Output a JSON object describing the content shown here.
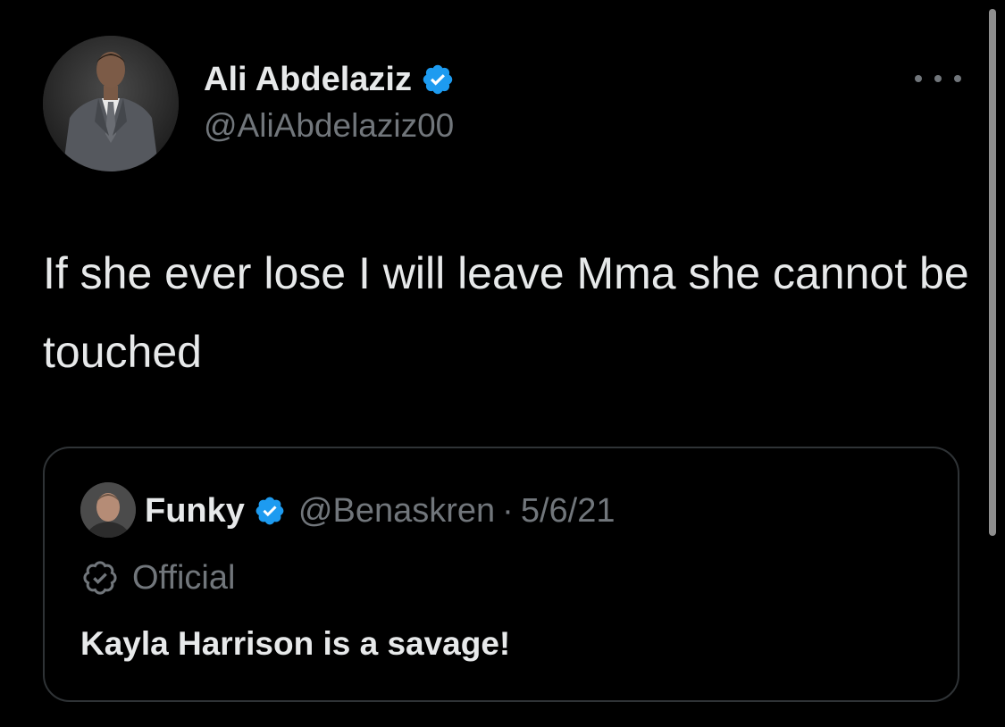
{
  "author": {
    "display_name": "Ali Abdelaziz",
    "handle": "@AliAbdelaziz00",
    "verified": true,
    "avatar_icon": "person-in-suit-avatar"
  },
  "tweet": {
    "text": "If she ever lose I will leave Mma she cannot be touched"
  },
  "more_icon": "ellipsis-icon",
  "quoted_tweet": {
    "display_name": "Funky",
    "handle": "@Benaskren",
    "separator": "·",
    "date": "5/6/21",
    "verified": true,
    "label": "Official",
    "label_icon": "official-badge-icon",
    "text": "Kayla Harrison is a savage!"
  },
  "colors": {
    "background": "#000000",
    "primary_text": "#e7e9ea",
    "secondary_text": "#71767b",
    "verified_blue": "#1d9bf0",
    "border": "#2f3336"
  }
}
